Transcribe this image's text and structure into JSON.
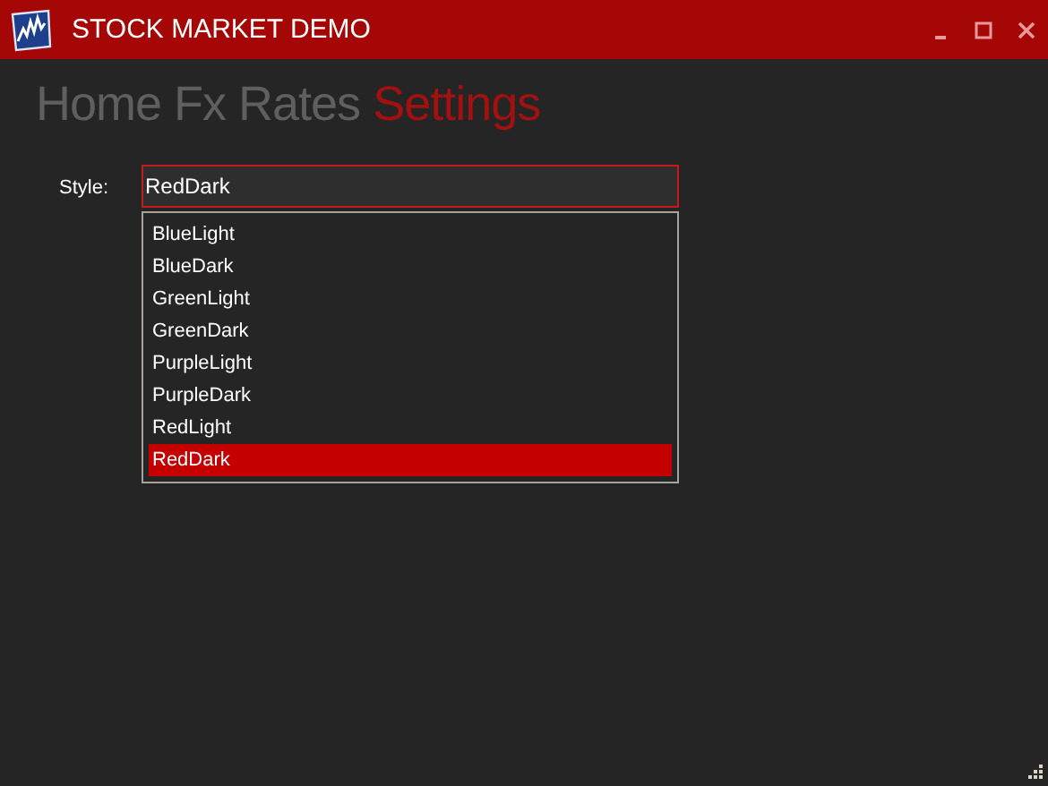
{
  "window": {
    "title": "STOCK MARKET DEMO"
  },
  "nav": [
    {
      "label": "Home",
      "selected": false
    },
    {
      "label": "Fx Rates",
      "selected": false
    },
    {
      "label": "Settings",
      "selected": true
    }
  ],
  "style_field": {
    "label": "Style:",
    "value": "RedDark",
    "expanded": true,
    "options": [
      {
        "label": "BlueLight",
        "selected": false
      },
      {
        "label": "BlueDark",
        "selected": false
      },
      {
        "label": "GreenLight",
        "selected": false
      },
      {
        "label": "GreenDark",
        "selected": false
      },
      {
        "label": "PurpleLight",
        "selected": false
      },
      {
        "label": "PurpleDark",
        "selected": false
      },
      {
        "label": "RedLight",
        "selected": false
      },
      {
        "label": "RedDark",
        "selected": true
      }
    ]
  }
}
